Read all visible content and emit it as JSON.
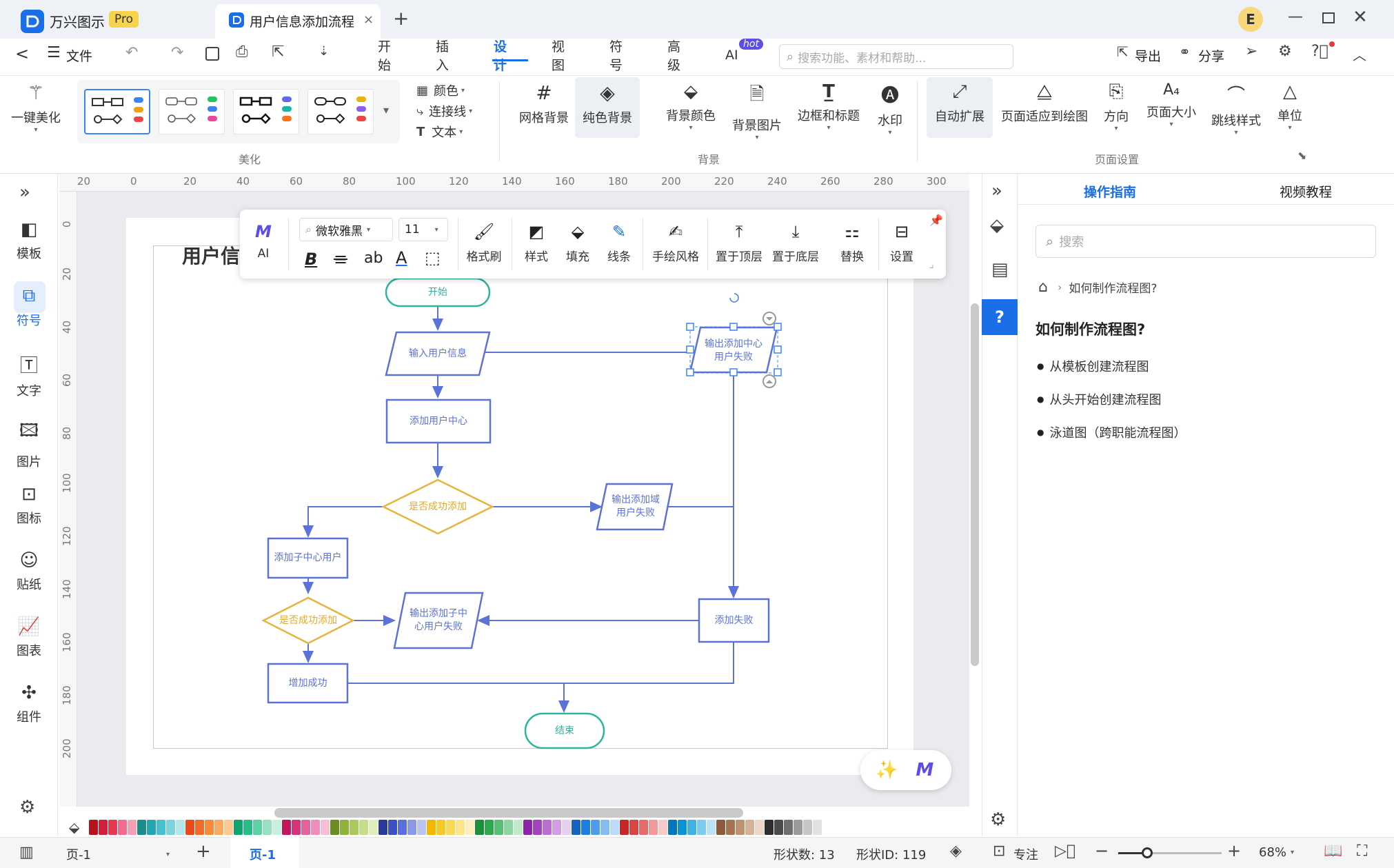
{
  "app": {
    "name": "万兴图示",
    "badge": "Pro",
    "doc_tab": "用户信息添加流程",
    "user_initial": "E"
  },
  "menu": {
    "back": "<",
    "file": "文件",
    "tabs": [
      "开始",
      "插入",
      "设计",
      "视图",
      "符号",
      "高级",
      "AI"
    ],
    "active_tab": "设计",
    "ai_badge": "hot",
    "search_placeholder": "搜索功能、素材和帮助...",
    "export": "导出",
    "share": "分享"
  },
  "ribbon": {
    "beautify": "一键美化",
    "beautify_group": "美化",
    "color": "颜色",
    "connector": "连接线",
    "text": "文本",
    "background_group": "背景",
    "grid_bg": "网格背景",
    "solid_bg": "纯色背景",
    "bg_color": "背景颜色",
    "bg_image": "背景图片",
    "border_title": "边框和标题",
    "watermark": "水印",
    "page_setup_group": "页面设置",
    "auto_expand": "自动扩展",
    "fit_page": "页面适应到绘图",
    "orientation": "方向",
    "page_size": "页面大小",
    "jump_style": "跳线样式",
    "unit": "单位"
  },
  "leftbar": {
    "items": [
      "模板",
      "符号",
      "文字",
      "图片",
      "图标",
      "贴纸",
      "图表",
      "组件"
    ],
    "active": "符号"
  },
  "rulers": {
    "top": [
      "20",
      "0",
      "20",
      "40",
      "60",
      "80",
      "100",
      "120",
      "140",
      "160",
      "180",
      "200",
      "220",
      "240",
      "260",
      "280",
      "300"
    ],
    "left": [
      "0",
      "20",
      "40",
      "60",
      "80",
      "100",
      "120",
      "140",
      "160",
      "180",
      "200"
    ]
  },
  "floatbar": {
    "ai": "AI",
    "font": "微软雅黑",
    "size": "11",
    "format_painter": "格式刷",
    "style": "样式",
    "fill": "填充",
    "line": "线条",
    "hand_drawn": "手绘风格",
    "bring_front": "置于顶层",
    "send_back": "置于底层",
    "replace": "替换",
    "settings": "设置",
    "bold": "B",
    "ab": "ab",
    "font_color": "A"
  },
  "diagram": {
    "title": "用户信",
    "start": "开始",
    "input_user": "输入用户信息",
    "add_center": "添加用户中心",
    "decision1": "是否成功添加",
    "output_domain_fail": "输出添加域用户失败",
    "output_center_fail": "输出添加中心用户失败",
    "add_sub_center": "添加子中心用户",
    "decision2": "是否成功添加",
    "output_sub_fail": "输出添加子中心用户失败",
    "add_fail": "添加失败",
    "add_success": "增加成功",
    "end": "结束"
  },
  "rightpanel": {
    "tabs": [
      "操作指南",
      "视频教程"
    ],
    "active_tab": "操作指南",
    "search_placeholder": "搜索",
    "breadcrumb": "如何制作流程图?",
    "heading": "如何制作流程图?",
    "links": [
      "从模板创建流程图",
      "从头开始创建流程图",
      "泳道图（跨职能流程图）"
    ]
  },
  "palette": [
    "#b5121b",
    "#d0213a",
    "#e8384f",
    "#f06b8c",
    "#f4a0b7",
    "#1c8c8c",
    "#22a6b3",
    "#48c1cf",
    "#7fd3dd",
    "#b4e6ec",
    "#e84c1c",
    "#f26a2a",
    "#f78a3c",
    "#fba862",
    "#fdc894",
    "#12a36e",
    "#2bbb86",
    "#5fd0a4",
    "#97e0c1",
    "#c9efdf",
    "#c2185b",
    "#d6337a",
    "#e66099",
    "#ef8eb8",
    "#f6bdd6",
    "#6b8e23",
    "#8db33a",
    "#a9c95c",
    "#c6dd8c",
    "#e0eebd",
    "#2b3a9a",
    "#3b50c2",
    "#5b6ee0",
    "#8b98ea",
    "#bcc3f3",
    "#f2b800",
    "#f7c928",
    "#fad855",
    "#fce48a",
    "#fdefbd",
    "#1b8f3a",
    "#2fa84f",
    "#58c072",
    "#8cd69f",
    "#c1eacb",
    "#8e24aa",
    "#a442bf",
    "#bb6dd1",
    "#d29de2",
    "#e8cff0",
    "#1565c0",
    "#1e7de0",
    "#4f9cec",
    "#85bdf3",
    "#bcdaf9",
    "#c62828",
    "#d84343",
    "#e56b6b",
    "#ef9999",
    "#f7c9c9",
    "#0277bd",
    "#0a93d9",
    "#3fb0e8",
    "#7ccbf0",
    "#b9e3f7",
    "#8d5a3c",
    "#a87352",
    "#c0916f",
    "#d6b299",
    "#ebd6c7",
    "#2e2e2e",
    "#4a4a4a",
    "#6e6e6e",
    "#9a9a9a",
    "#c6c6c6",
    "#e2e2e2"
  ],
  "status": {
    "page_menu": "页-1",
    "page_tab": "页-1",
    "shape_count": "形状数: 13",
    "shape_id": "形状ID: 119",
    "focus": "专注",
    "zoom": "68%",
    "zoom_level": 0.28
  }
}
